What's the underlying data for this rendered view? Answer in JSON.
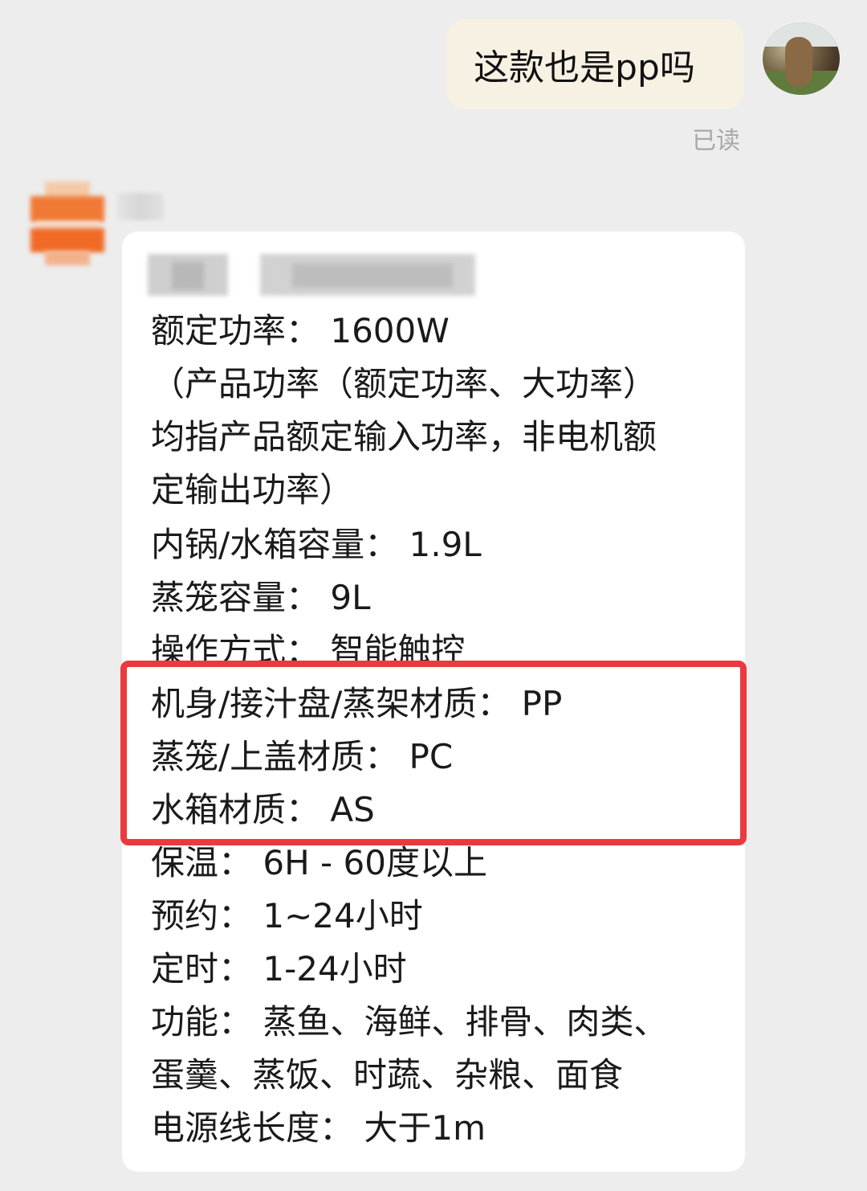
{
  "outgoing_message": {
    "text": "这款也是pp吗",
    "status": "已读"
  },
  "incoming_message": {
    "lines_before": [
      "额定功率：  1600W",
      "（产品功率（额定功率、大功率）",
      "均指产品额定输入功率，非电机额",
      "定输出功率）",
      "内锅/水箱容量：  1.9L",
      "蒸笼容量：  9L",
      "操作方式：  智能触控"
    ],
    "highlighted_lines": [
      "机身/接汁盘/蒸架材质：  PP",
      "蒸笼/上盖材质：  PC",
      "水箱材质：  AS"
    ],
    "lines_after": [
      "保温：  6H  -   60度以上",
      "预约：  1~24小时",
      "定时：  1-24小时",
      "功能：  蒸鱼、海鲜、排骨、肉类、",
      "蛋羹、蒸饭、时蔬、杂粮、面食",
      "电源线长度：  大于1m"
    ]
  },
  "colors": {
    "background": "#ededed",
    "outgoing_bubble": "#f7f1e3",
    "incoming_bubble": "#ffffff",
    "highlight_border": "#ea3a3f",
    "read_status": "#a8a8a8"
  }
}
